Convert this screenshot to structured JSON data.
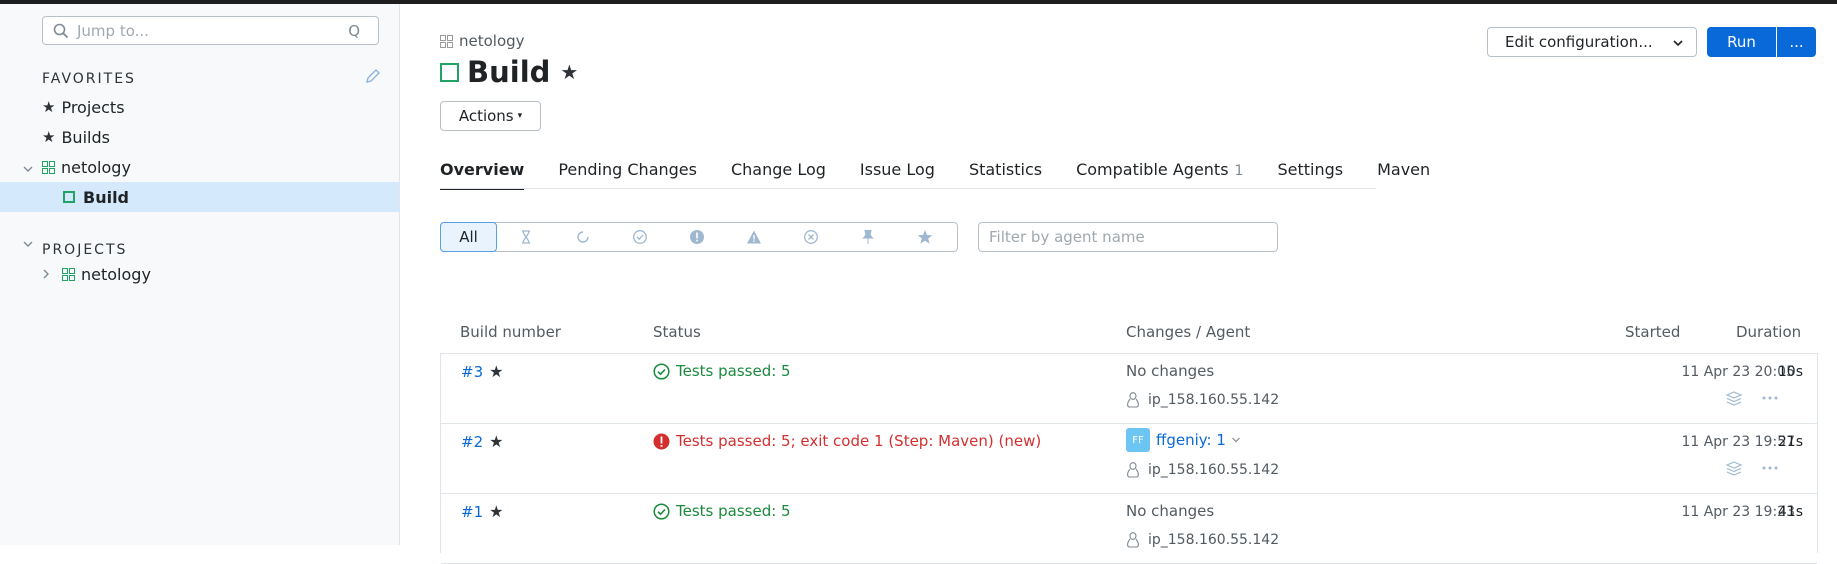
{
  "sidebar": {
    "search_placeholder": "Jump to...",
    "search_shortcut": "Q",
    "favorites_title": "FAVORITES",
    "favorites": [
      "Projects",
      "Builds"
    ],
    "project": "netology",
    "build": "Build",
    "projects_title": "PROJECTS",
    "projects_item": "netology"
  },
  "header": {
    "breadcrumb": "netology",
    "title": "Build",
    "actions_label": "Actions",
    "edit_label": "Edit configuration...",
    "run_label": "Run",
    "run_more_label": "..."
  },
  "tabs": [
    {
      "label": "Overview"
    },
    {
      "label": "Pending Changes"
    },
    {
      "label": "Change Log"
    },
    {
      "label": "Issue Log"
    },
    {
      "label": "Statistics"
    },
    {
      "label": "Compatible Agents",
      "count": "1"
    },
    {
      "label": "Settings"
    },
    {
      "label": "Maven"
    }
  ],
  "filters": {
    "all_label": "All",
    "agent_placeholder": "Filter by agent name"
  },
  "table": {
    "headers": {
      "build_number": "Build number",
      "status": "Status",
      "changes": "Changes / Agent",
      "started": "Started",
      "duration": "Duration"
    },
    "rows": [
      {
        "number": "#3",
        "status": "Tests passed: 5",
        "changes": "No changes",
        "agent": "ip_158.160.55.142",
        "started": "11 Apr 23 20:05",
        "duration": "10s"
      },
      {
        "number": "#2",
        "status": "Tests passed: 5; exit code 1 (Step: Maven) (new)",
        "avatar": "FF",
        "user": "ffgeniy: 1",
        "agent": "ip_158.160.55.142",
        "started": "11 Apr 23 19:57",
        "duration": "21s"
      },
      {
        "number": "#1",
        "status": "Tests passed: 5",
        "changes": "No changes",
        "agent": "ip_158.160.55.142",
        "started": "11 Apr 23 19:23",
        "duration": "41s"
      }
    ]
  },
  "colors": {
    "accent": "#0a69d8",
    "success": "#1a8a3c",
    "error": "#d32f2f",
    "selected": "#d4e9fb"
  }
}
